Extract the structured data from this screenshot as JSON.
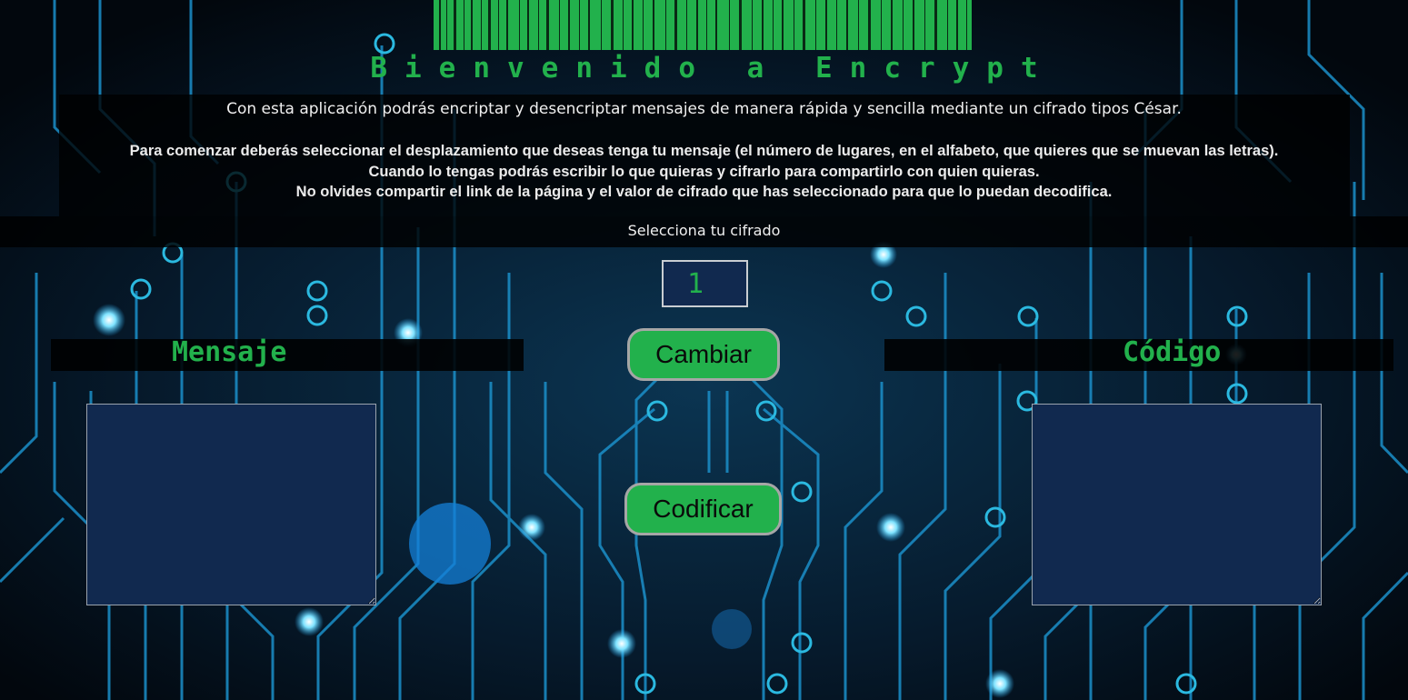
{
  "header": {
    "title": "Bienvenido a Encrypt"
  },
  "intro": {
    "tagline": "Con esta aplicación podrás encriptar y desencriptar mensajes de manera rápida y sencilla mediante un cifrado tipos César.",
    "paragraphs": [
      "Para comenzar deberás seleccionar el desplazamiento que deseas tenga tu mensaje (el número de lugares, en el alfabeto, que quieres que se muevan las letras).",
      "Cuando lo tengas podrás escribir lo que quieras y cifrarlo para compartirlo con quien quieras.",
      "No olvides compartir el link de la página y el valor de cifrado que has seleccionado para que lo puedan decodifica."
    ]
  },
  "cipher": {
    "label": "Selecciona tu cifrado",
    "shift_value": "1"
  },
  "buttons": {
    "change_label": "Cambiar",
    "encode_label": "Codificar"
  },
  "message": {
    "heading": "Mensaje",
    "value": ""
  },
  "code": {
    "heading": "Código",
    "value": ""
  },
  "colors": {
    "accent": "#22b14c",
    "field_bg": "#11294f",
    "page_bg": "#04101c",
    "circuit": "#1aa6d8"
  },
  "icons": {
    "barcode": "barcode-graphic",
    "background": "circuit-board-background"
  }
}
